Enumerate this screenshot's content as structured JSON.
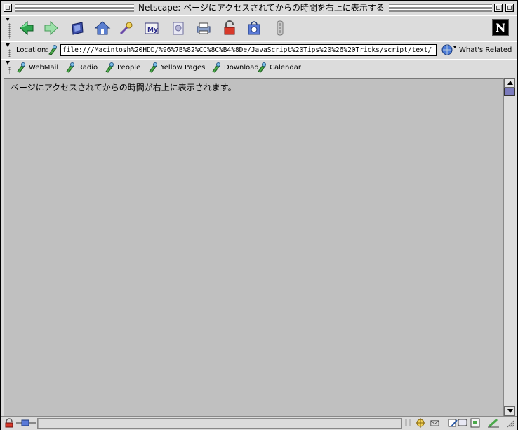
{
  "window": {
    "title": "Netscape: ページにアクセスされてからの時間を右上に表示する"
  },
  "navigation_toolbar": {
    "buttons": [
      {
        "name": "back",
        "icon": "back-arrow-icon"
      },
      {
        "name": "forward",
        "icon": "forward-arrow-icon"
      },
      {
        "name": "reload",
        "icon": "reload-icon"
      },
      {
        "name": "home",
        "icon": "home-icon"
      },
      {
        "name": "search",
        "icon": "search-icon"
      },
      {
        "name": "my-netscape",
        "icon": "my-netscape-icon",
        "label": "My"
      },
      {
        "name": "images",
        "icon": "images-icon"
      },
      {
        "name": "print",
        "icon": "print-icon"
      },
      {
        "name": "security",
        "icon": "security-lock-icon"
      },
      {
        "name": "shop",
        "icon": "shop-icon"
      },
      {
        "name": "stop",
        "icon": "stop-icon"
      }
    ],
    "logo": "N"
  },
  "location_bar": {
    "label": "Location:",
    "url": "file:///Macintosh%20HDD/%96%7B%82%CC%8C%B4%8De/JavaScript%20Tips%20%26%20Tricks/script/text/",
    "related_label": "What's Related"
  },
  "personal_toolbar": {
    "items": [
      {
        "label": "WebMail"
      },
      {
        "label": "Radio"
      },
      {
        "label": "People"
      },
      {
        "label": "Yellow Pages"
      },
      {
        "label": "Download"
      },
      {
        "label": "Calendar"
      }
    ]
  },
  "content": {
    "text": "ページにアクセスされてからの時間が右上に表示されます。"
  },
  "colors": {
    "content_background": "#c0c0c0",
    "chrome": "#dcdcdc",
    "scroll_thumb": "#7b7bbd"
  }
}
